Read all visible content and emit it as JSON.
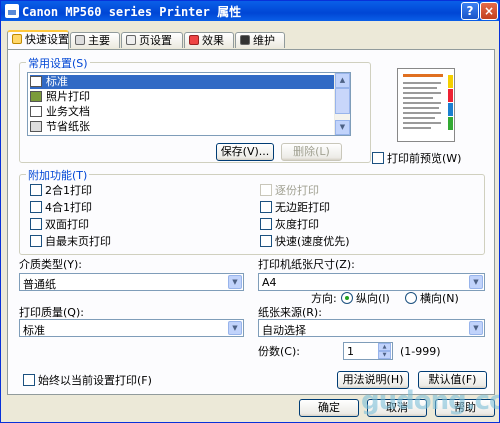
{
  "window": {
    "title": "Canon MP560 series Printer 属性",
    "help_label": "?",
    "close_label": "×"
  },
  "tabs": [
    {
      "label": "快速设置",
      "active": true
    },
    {
      "label": "主要",
      "active": false
    },
    {
      "label": "页设置",
      "active": false
    },
    {
      "label": "效果",
      "active": false
    },
    {
      "label": "维护",
      "active": false
    }
  ],
  "common_settings": {
    "title": "常用设置(S)",
    "items": [
      "标准",
      "照片打印",
      "业务文档",
      "节省纸张"
    ],
    "selected_index": 0,
    "save_label": "保存(V)...",
    "delete_label": "删除(L)"
  },
  "preview_checkbox": {
    "label": "打印前预览(W)",
    "checked": false
  },
  "additional": {
    "title": "附加功能(T)",
    "left": [
      {
        "label": "2合1打印",
        "checked": false,
        "enabled": true
      },
      {
        "label": "4合1打印",
        "checked": false,
        "enabled": true
      },
      {
        "label": "双面打印",
        "checked": false,
        "enabled": true
      },
      {
        "label": "自最末页打印",
        "checked": false,
        "enabled": true
      }
    ],
    "right": [
      {
        "label": "逐份打印",
        "checked": false,
        "enabled": false
      },
      {
        "label": "无边距打印",
        "checked": false,
        "enabled": true
      },
      {
        "label": "灰度打印",
        "checked": false,
        "enabled": true
      },
      {
        "label": "快速(速度优先)",
        "checked": false,
        "enabled": true
      }
    ]
  },
  "media_type": {
    "label": "介质类型(Y):",
    "value": "普通纸"
  },
  "paper_size": {
    "label": "打印机纸张尺寸(Z):",
    "value": "A4"
  },
  "orientation": {
    "label": "方向:",
    "options": [
      {
        "label": "纵向(I)",
        "selected": true
      },
      {
        "label": "横向(N)",
        "selected": false
      }
    ]
  },
  "print_quality": {
    "label": "打印质量(Q):",
    "value": "标准"
  },
  "paper_source": {
    "label": "纸张来源(R):",
    "value": "自动选择"
  },
  "copies": {
    "label": "份数(C):",
    "value": "1",
    "range": "(1-999)"
  },
  "always_print_checkbox": {
    "label": "始终以当前设置打印(F)",
    "checked": false
  },
  "buttons": {
    "instructions": "用法说明(H)",
    "defaults": "默认值(F)",
    "ok": "确定",
    "cancel": "取消",
    "help": "帮助"
  },
  "watermark": "gudong.com",
  "colors": {
    "title_bar": "#0054E3",
    "dialog_bg": "#ECE9D8",
    "selection": "#316AC5",
    "group_title": "#0046D5"
  }
}
